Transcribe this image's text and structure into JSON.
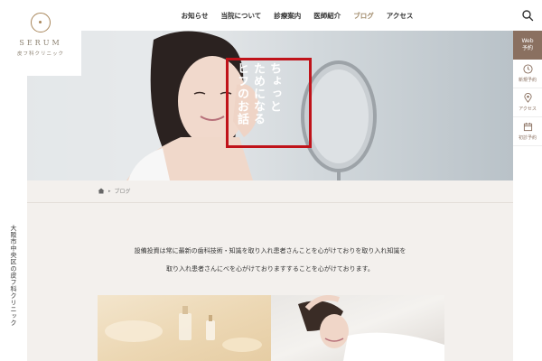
{
  "logo": {
    "name": "SERUM",
    "sub": "皮フ科クリニック"
  },
  "side_vertical_text": "大阪市中央区の皮フ科クリニック",
  "nav": {
    "items": [
      {
        "label": "お知らせ",
        "active": false
      },
      {
        "label": "当院について",
        "active": false
      },
      {
        "label": "診療案内",
        "active": false
      },
      {
        "label": "医師紹介",
        "active": false
      },
      {
        "label": "ブログ",
        "active": true
      },
      {
        "label": "アクセス",
        "active": false
      }
    ],
    "search_icon": "search-icon"
  },
  "sidenav": {
    "web": {
      "line1": "Web",
      "line2": "予約"
    },
    "items": [
      {
        "label": "新規予約",
        "icon": "clock-icon"
      },
      {
        "label": "アクセス",
        "icon": "map-pin-icon"
      },
      {
        "label": "初診予約",
        "icon": "calendar-icon"
      }
    ]
  },
  "hero": {
    "caption_lines": [
      "ちょっと",
      "ためになる",
      "ヒフのお話"
    ],
    "frame_color": "#c0131a"
  },
  "breadcrumb": {
    "home_icon": "home-icon",
    "current": "ブログ"
  },
  "intro": {
    "line1": "設備投資は常に最新の歯科技術・知識を取り入れ患者さんことを心がけておりを取り入れ知識を",
    "line2": "取り入れ患者さんにべを心がけておりますすることを心がけております。"
  },
  "colors": {
    "accent": "#a08a6a",
    "side_web_bg": "#8a7060",
    "content_bg": "#f3f0ed"
  }
}
